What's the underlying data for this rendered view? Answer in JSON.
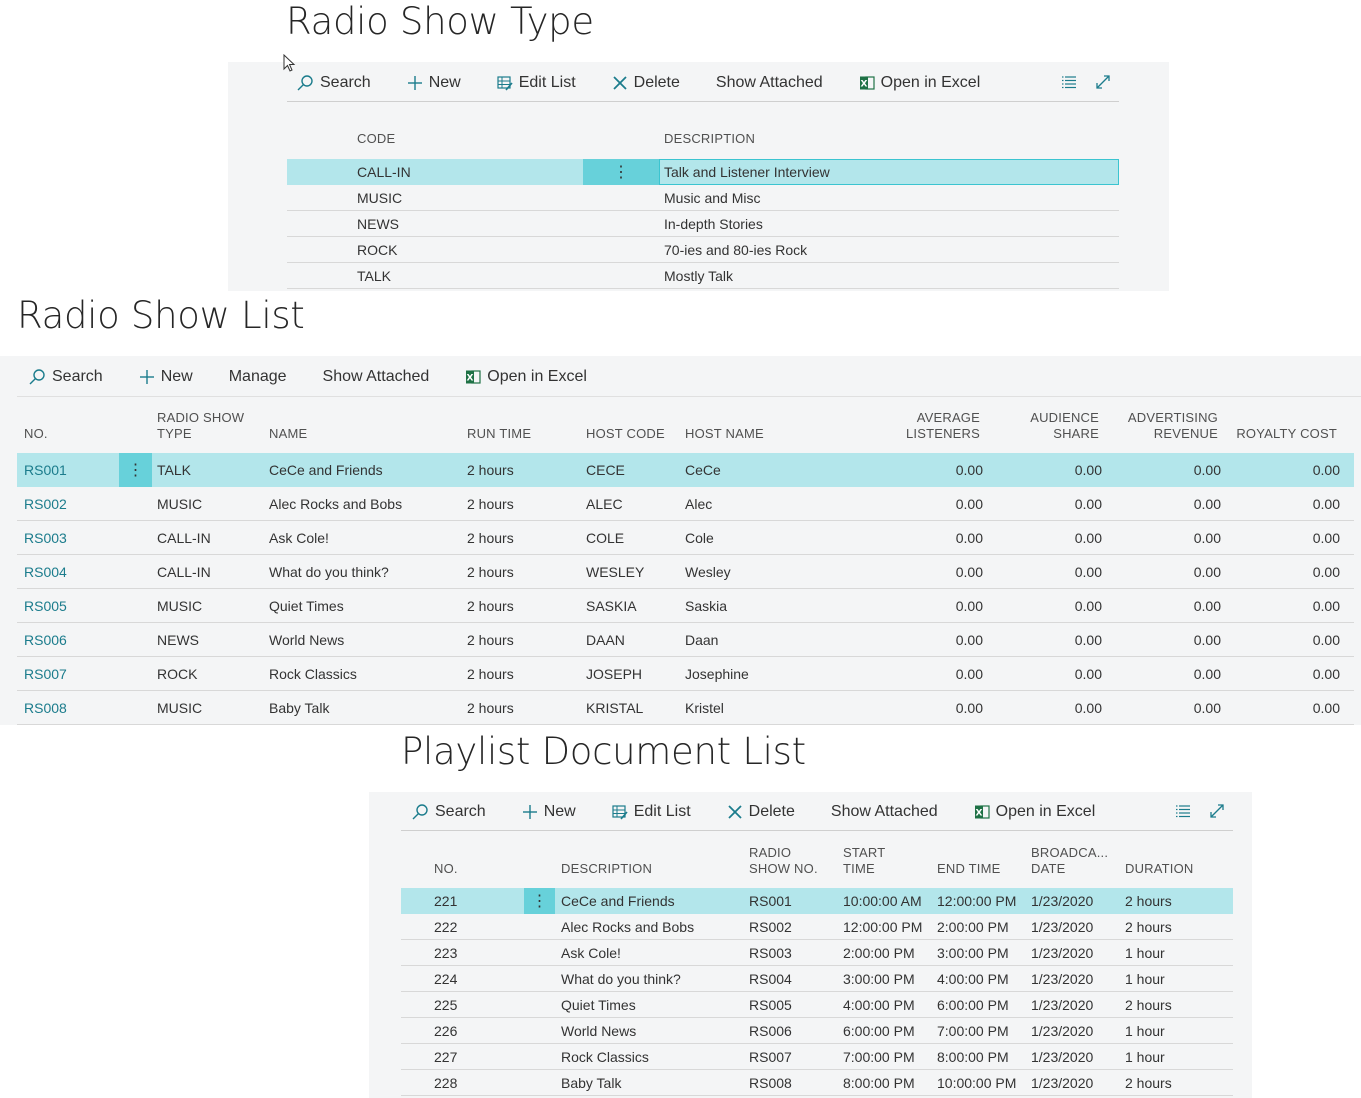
{
  "show_types": {
    "title": "Radio Show Type",
    "toolbar": {
      "search": "Search",
      "new": "New",
      "edit_list": "Edit List",
      "delete": "Delete",
      "show_attached": "Show Attached",
      "open_excel": "Open in Excel"
    },
    "columns": {
      "code": "CODE",
      "description": "DESCRIPTION"
    },
    "rows": [
      {
        "code": "CALL-IN",
        "description": "Talk and Listener Interview"
      },
      {
        "code": "MUSIC",
        "description": "Music and Misc"
      },
      {
        "code": "NEWS",
        "description": "In-depth Stories"
      },
      {
        "code": "ROCK",
        "description": "70-ies and 80-ies Rock"
      },
      {
        "code": "TALK",
        "description": "Mostly Talk"
      }
    ]
  },
  "show_list": {
    "title": "Radio Show List",
    "toolbar": {
      "search": "Search",
      "new": "New",
      "manage": "Manage",
      "show_attached": "Show Attached",
      "open_excel": "Open in Excel"
    },
    "columns": {
      "no": "NO.",
      "type_line1": "RADIO SHOW",
      "type_line2": "TYPE",
      "name": "NAME",
      "run_time": "RUN TIME",
      "host_code": "HOST CODE",
      "host_name": "HOST NAME",
      "avg_line1": "AVERAGE",
      "avg_line2": "LISTENERS",
      "share_line1": "AUDIENCE",
      "share_line2": "SHARE",
      "rev_line1": "ADVERTISING",
      "rev_line2": "REVENUE",
      "royalty": "ROYALTY COST"
    },
    "rows": [
      {
        "no": "RS001",
        "type": "TALK",
        "name": "CeCe and Friends",
        "run_time": "2 hours",
        "host_code": "CECE",
        "host_name": "CeCe",
        "avg": "0.00",
        "share": "0.00",
        "revenue": "0.00",
        "royalty": "0.00"
      },
      {
        "no": "RS002",
        "type": "MUSIC",
        "name": "Alec Rocks and Bobs",
        "run_time": "2 hours",
        "host_code": "ALEC",
        "host_name": "Alec",
        "avg": "0.00",
        "share": "0.00",
        "revenue": "0.00",
        "royalty": "0.00"
      },
      {
        "no": "RS003",
        "type": "CALL-IN",
        "name": "Ask Cole!",
        "run_time": "2 hours",
        "host_code": "COLE",
        "host_name": "Cole",
        "avg": "0.00",
        "share": "0.00",
        "revenue": "0.00",
        "royalty": "0.00"
      },
      {
        "no": "RS004",
        "type": "CALL-IN",
        "name": "What do you think?",
        "run_time": "2 hours",
        "host_code": "WESLEY",
        "host_name": "Wesley",
        "avg": "0.00",
        "share": "0.00",
        "revenue": "0.00",
        "royalty": "0.00"
      },
      {
        "no": "RS005",
        "type": "MUSIC",
        "name": "Quiet Times",
        "run_time": "2 hours",
        "host_code": "SASKIA",
        "host_name": "Saskia",
        "avg": "0.00",
        "share": "0.00",
        "revenue": "0.00",
        "royalty": "0.00"
      },
      {
        "no": "RS006",
        "type": "NEWS",
        "name": "World News",
        "run_time": "2 hours",
        "host_code": "DAAN",
        "host_name": "Daan",
        "avg": "0.00",
        "share": "0.00",
        "revenue": "0.00",
        "royalty": "0.00"
      },
      {
        "no": "RS007",
        "type": "ROCK",
        "name": "Rock Classics",
        "run_time": "2 hours",
        "host_code": "JOSEPH",
        "host_name": "Josephine",
        "avg": "0.00",
        "share": "0.00",
        "revenue": "0.00",
        "royalty": "0.00"
      },
      {
        "no": "RS008",
        "type": "MUSIC",
        "name": "Baby Talk",
        "run_time": "2 hours",
        "host_code": "KRISTAL",
        "host_name": "Kristel",
        "avg": "0.00",
        "share": "0.00",
        "revenue": "0.00",
        "royalty": "0.00"
      }
    ]
  },
  "playlist": {
    "title": "Playlist Document List",
    "toolbar": {
      "search": "Search",
      "new": "New",
      "edit_list": "Edit List",
      "delete": "Delete",
      "show_attached": "Show Attached",
      "open_excel": "Open in Excel"
    },
    "columns": {
      "no": "NO.",
      "description": "DESCRIPTION",
      "show_line1": "RADIO",
      "show_line2": "SHOW NO.",
      "start_line1": "START",
      "start_line2": "TIME",
      "end": "END TIME",
      "bdate_line1": "BROADCA...",
      "bdate_line2": "DATE",
      "duration": "DURATION"
    },
    "rows": [
      {
        "no": "221",
        "description": "CeCe and Friends",
        "show_no": "RS001",
        "start": "10:00:00 AM",
        "end": "12:00:00 PM",
        "date": "1/23/2020",
        "duration": "2 hours"
      },
      {
        "no": "222",
        "description": "Alec Rocks and Bobs",
        "show_no": "RS002",
        "start": "12:00:00 PM",
        "end": "2:00:00 PM",
        "date": "1/23/2020",
        "duration": "2 hours"
      },
      {
        "no": "223",
        "description": "Ask Cole!",
        "show_no": "RS003",
        "start": "2:00:00 PM",
        "end": "3:00:00 PM",
        "date": "1/23/2020",
        "duration": "1 hour"
      },
      {
        "no": "224",
        "description": "What do you think?",
        "show_no": "RS004",
        "start": "3:00:00 PM",
        "end": "4:00:00 PM",
        "date": "1/23/2020",
        "duration": "1 hour"
      },
      {
        "no": "225",
        "description": "Quiet Times",
        "show_no": "RS005",
        "start": "4:00:00 PM",
        "end": "6:00:00 PM",
        "date": "1/23/2020",
        "duration": "2 hours"
      },
      {
        "no": "226",
        "description": "World News",
        "show_no": "RS006",
        "start": "6:00:00 PM",
        "end": "7:00:00 PM",
        "date": "1/23/2020",
        "duration": "1 hour"
      },
      {
        "no": "227",
        "description": "Rock Classics",
        "show_no": "RS007",
        "start": "7:00:00 PM",
        "end": "8:00:00 PM",
        "date": "1/23/2020",
        "duration": "1 hour"
      },
      {
        "no": "228",
        "description": "Baby Talk",
        "show_no": "RS008",
        "start": "8:00:00 PM",
        "end": "10:00:00 PM",
        "date": "1/23/2020",
        "duration": "2 hours"
      }
    ]
  }
}
